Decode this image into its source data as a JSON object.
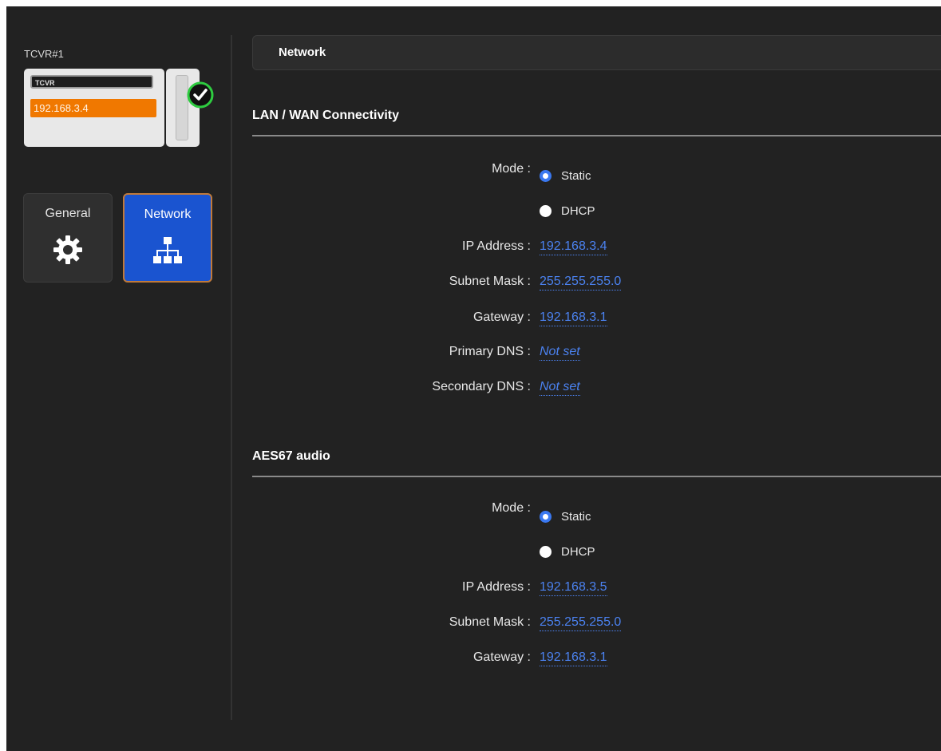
{
  "device": {
    "title": "TCVR#1",
    "name": "TCVR",
    "ip": "192.168.3.4",
    "status": "online"
  },
  "nav": {
    "general_label": "General",
    "network_label": "Network",
    "active": "Network"
  },
  "header": {
    "title": "Network"
  },
  "lan": {
    "title": "LAN / WAN Connectivity",
    "mode_label": "Mode :",
    "mode_options": [
      "Static",
      "DHCP"
    ],
    "mode_selected": "Static",
    "ip_label": "IP Address :",
    "ip_value": "192.168.3.4",
    "subnet_label": "Subnet Mask :",
    "subnet_value": "255.255.255.0",
    "gateway_label": "Gateway :",
    "gateway_value": "192.168.3.1",
    "dns1_label": "Primary DNS :",
    "dns1_value": "Not set",
    "dns2_label": "Secondary DNS :",
    "dns2_value": "Not set"
  },
  "aes": {
    "title": "AES67 audio",
    "mode_label": "Mode :",
    "mode_options": [
      "Static",
      "DHCP"
    ],
    "mode_selected": "Static",
    "ip_label": "IP Address :",
    "ip_value": "192.168.3.5",
    "subnet_label": "Subnet Mask :",
    "subnet_value": "255.255.255.0",
    "gateway_label": "Gateway :",
    "gateway_value": "192.168.3.1"
  },
  "colors": {
    "accent": "#1a54d0",
    "link": "#4b82f0",
    "device_ip": "#f07800",
    "status_ok": "#2ecc40"
  }
}
